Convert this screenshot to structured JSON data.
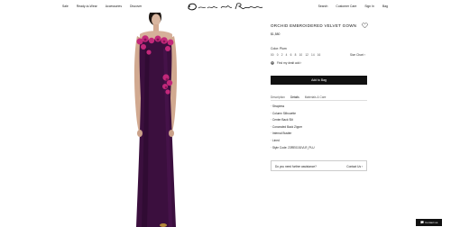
{
  "nav": {
    "left": [
      "Sale",
      "Ready-to-Wear",
      "Accessories",
      "Discover"
    ],
    "right": [
      "Search",
      "Customer Care",
      "Sign In",
      "Bag"
    ]
  },
  "brand": {
    "logo_icon": "oscar-de-la-renta-signature-logo"
  },
  "product": {
    "title": "ORCHID EMBROIDERED VELVET GOWN",
    "price": "$1,580",
    "color_label": "Color: Plum",
    "swatch_color": "#3a1040",
    "sizes": [
      "00",
      "0",
      "2",
      "4",
      "6",
      "8",
      "10",
      "12",
      "14",
      "16"
    ],
    "size_chart": "Size Chart ›",
    "find_in_store": "Find my dealt add ›",
    "add_to_bag": "Add to Bag"
  },
  "tabs": [
    "Description",
    "Details",
    "Materials & Care"
  ],
  "active_tab": "Details",
  "details": [
    "Strapless",
    "Column Silhouette",
    "Center Back Slit",
    "Concealed Back Zipper",
    "Internal Bustier",
    "Lined",
    "Style Code: 23RE0151VLR_PLU"
  ],
  "assistance": {
    "question": "Do you need further assistance?",
    "link": "Contact Us ›"
  },
  "contact_widget": "Contact us",
  "icons": {
    "wishlist": "heart-icon",
    "store": "location-pin-icon",
    "chat": "chat-bubble-icon"
  },
  "colors": {
    "gown": "#3b0f3e",
    "flowers": "#c2287a",
    "button": "#111111"
  }
}
